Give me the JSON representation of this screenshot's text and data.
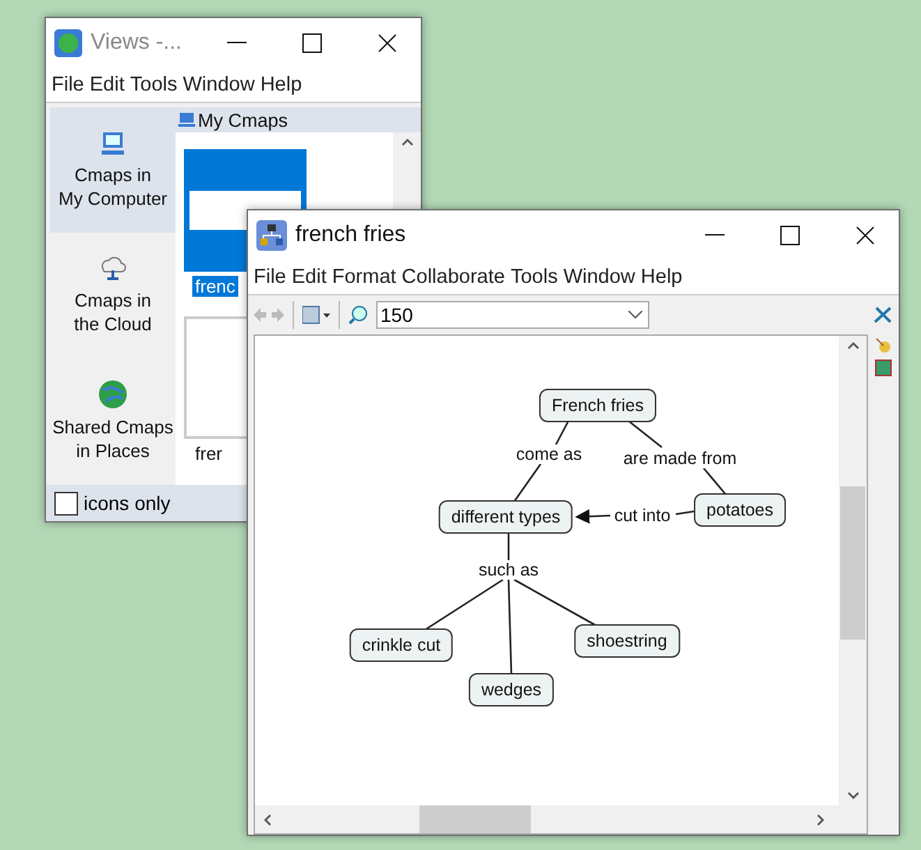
{
  "views_window": {
    "title": "Views -...",
    "menu": [
      "File",
      "Edit",
      "Tools",
      "Window",
      "Help"
    ],
    "sidebar": [
      {
        "label": "Cmaps in\nMy Computer",
        "selected": true
      },
      {
        "label": "Cmaps in\nthe Cloud",
        "selected": false
      },
      {
        "label": "Shared Cmaps\nin Places",
        "selected": false
      }
    ],
    "pane_title": "My Cmaps",
    "thumbnails": [
      {
        "label": "frenc",
        "selected": true
      },
      {
        "label": "frer",
        "selected": false
      }
    ],
    "icons_only": {
      "label": "icons only",
      "checked": false
    }
  },
  "map_window": {
    "title": "french fries",
    "menu": [
      "File",
      "Edit",
      "Format",
      "Collaborate",
      "Tools",
      "Window",
      "Help"
    ],
    "zoom": "150",
    "concepts": [
      "French fries",
      "different types",
      "potatoes",
      "crinkle cut",
      "wedges",
      "shoestring"
    ],
    "linking_phrases": [
      "come as",
      "are made from",
      "cut into",
      "such as"
    ]
  }
}
